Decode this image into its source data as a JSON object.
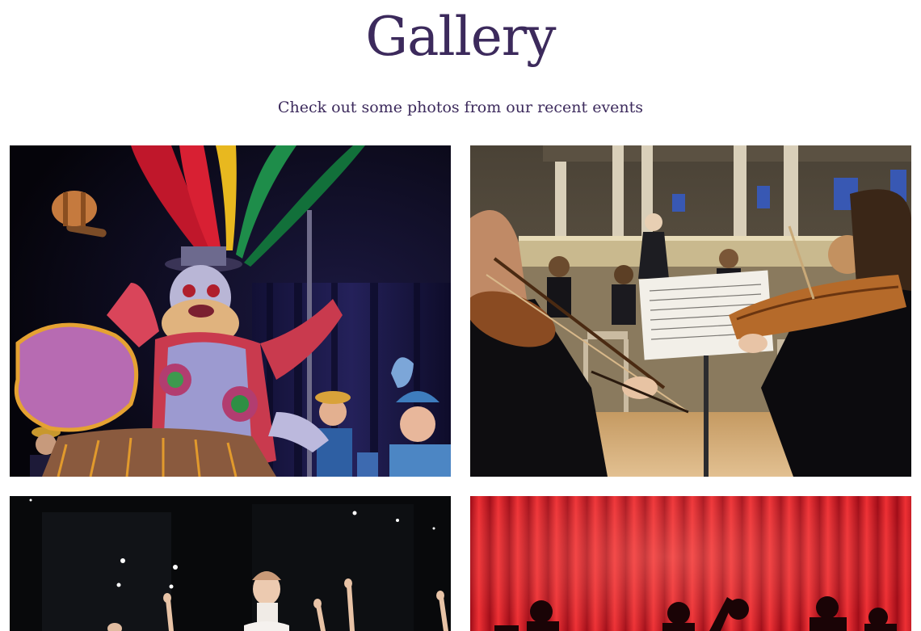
{
  "gallery": {
    "title": "Gallery",
    "subtitle": "Check out some photos from our recent events"
  },
  "photos": [
    {
      "subject": "costumed-dancer-photo"
    },
    {
      "subject": "orchestra-violinists-photo"
    },
    {
      "subject": "ballet-dancers-photo"
    },
    {
      "subject": "red-curtain-stage-photo"
    }
  ],
  "colors": {
    "heading": "#3c2a5c",
    "background": "#ffffff"
  }
}
